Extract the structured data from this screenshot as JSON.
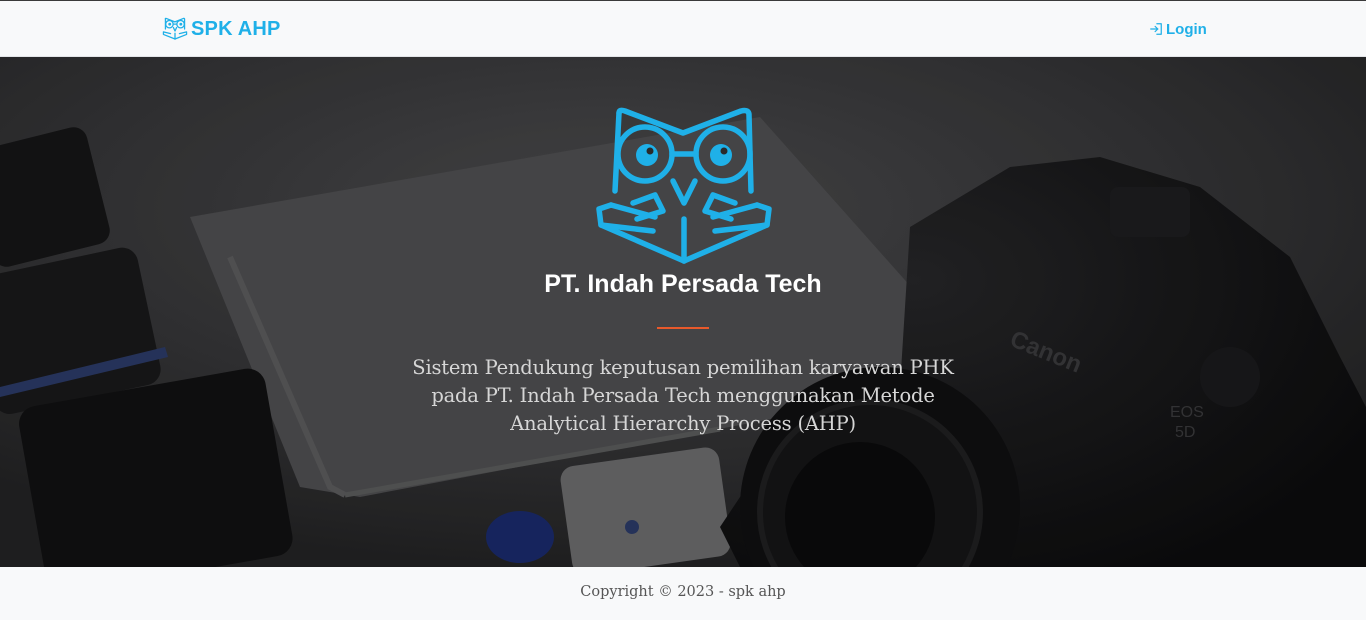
{
  "navbar": {
    "brand_label": "SPK AHP",
    "brand_icon": "owl-reading-book-icon",
    "login_label": "Login",
    "login_icon": "login-arrow-icon",
    "accent_color": "#1fb0e8"
  },
  "hero": {
    "logo_icon": "owl-reading-book-icon",
    "title": "PT. Indah Persada Tech",
    "description": "Sistem Pendukung keputusan pemilihan karyawan PHK pada PT. Indah Persada Tech menggunakan Metode Analytical Hierarchy Process (AHP)",
    "divider_color": "#e8592b",
    "background_image": "desk-with-phones-and-canon-camera"
  },
  "footer": {
    "copyright": "Copyright © 2023 - spk ahp"
  }
}
